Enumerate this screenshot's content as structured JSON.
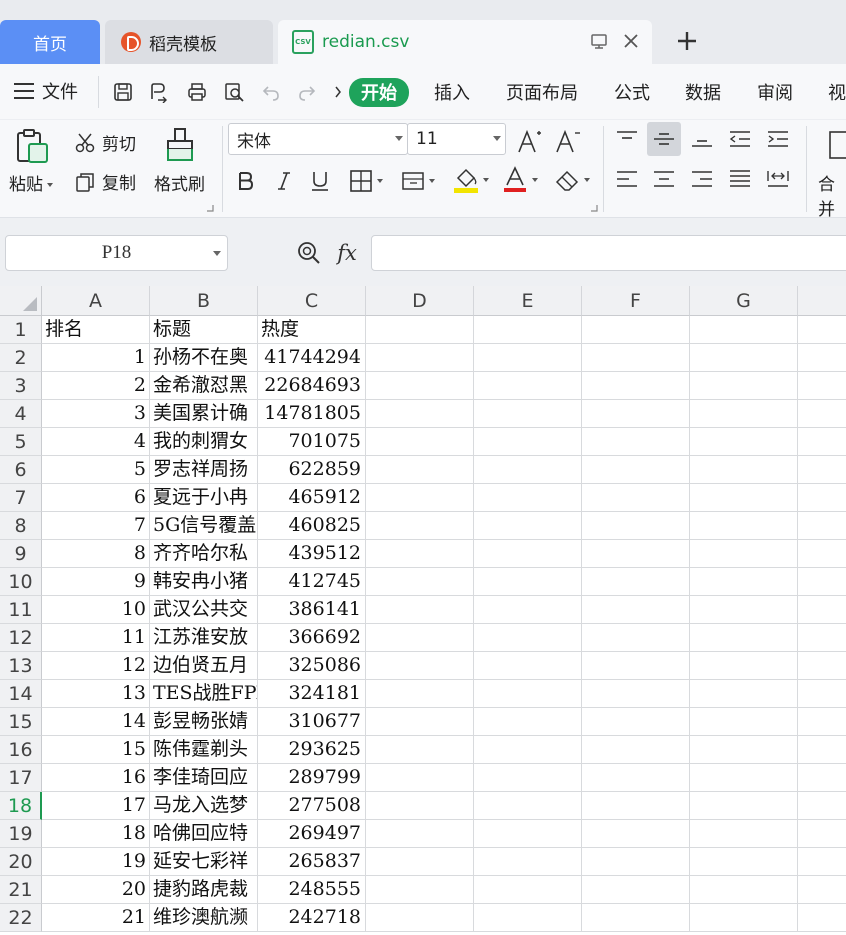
{
  "tabs": {
    "home": "首页",
    "docer": "稻壳模板",
    "file": "redian.csv",
    "file_icon_text": "CSV"
  },
  "menu": {
    "file": "文件",
    "tabs": [
      "开始",
      "插入",
      "页面布局",
      "公式",
      "数据",
      "审阅",
      "视"
    ]
  },
  "ribbon": {
    "paste": "粘贴",
    "cut": "剪切",
    "copy": "复制",
    "format_painter": "格式刷",
    "font_name": "宋体",
    "font_size": "11",
    "merge": "合并"
  },
  "formula_bar": {
    "name_box": "P18",
    "fx": "fx",
    "formula": ""
  },
  "sheet": {
    "columns": [
      "A",
      "B",
      "C",
      "D",
      "E",
      "F",
      "G"
    ],
    "selected_row": "18",
    "rows": [
      {
        "num": "1",
        "a": "排名",
        "b": "标题",
        "c": "热度"
      },
      {
        "num": "2",
        "a": "1",
        "b": "孙杨不在奥",
        "c": "41744294"
      },
      {
        "num": "3",
        "a": "2",
        "b": "金希澈怼黑",
        "c": "22684693"
      },
      {
        "num": "4",
        "a": "3",
        "b": "美国累计确",
        "c": "14781805"
      },
      {
        "num": "5",
        "a": "4",
        "b": "我的刺猬女",
        "c": "701075"
      },
      {
        "num": "6",
        "a": "5",
        "b": "罗志祥周扬",
        "c": "622859"
      },
      {
        "num": "7",
        "a": "6",
        "b": "夏远于小冉",
        "c": "465912"
      },
      {
        "num": "8",
        "a": "7",
        "b": "5G信号覆盖",
        "c": "460825"
      },
      {
        "num": "9",
        "a": "8",
        "b": "齐齐哈尔私",
        "c": "439512"
      },
      {
        "num": "10",
        "a": "9",
        "b": "韩安冉小猪",
        "c": "412745"
      },
      {
        "num": "11",
        "a": "10",
        "b": "武汉公共交",
        "c": "386141"
      },
      {
        "num": "12",
        "a": "11",
        "b": "江苏淮安放",
        "c": "366692"
      },
      {
        "num": "13",
        "a": "12",
        "b": "边伯贤五月",
        "c": "325086"
      },
      {
        "num": "14",
        "a": "13",
        "b": "TES战胜FPX",
        "c": "324181"
      },
      {
        "num": "15",
        "a": "14",
        "b": "彭昱畅张婧",
        "c": "310677"
      },
      {
        "num": "16",
        "a": "15",
        "b": "陈伟霆剃头",
        "c": "293625"
      },
      {
        "num": "17",
        "a": "16",
        "b": "李佳琦回应",
        "c": "289799"
      },
      {
        "num": "18",
        "a": "17",
        "b": "马龙入选梦",
        "c": "277508"
      },
      {
        "num": "19",
        "a": "18",
        "b": "哈佛回应特",
        "c": "269497"
      },
      {
        "num": "20",
        "a": "19",
        "b": "延安七彩祥",
        "c": "265837"
      },
      {
        "num": "21",
        "a": "20",
        "b": "捷豹路虎裁",
        "c": "248555"
      },
      {
        "num": "22",
        "a": "21",
        "b": "维珍澳航濒",
        "c": "242718"
      }
    ]
  }
}
